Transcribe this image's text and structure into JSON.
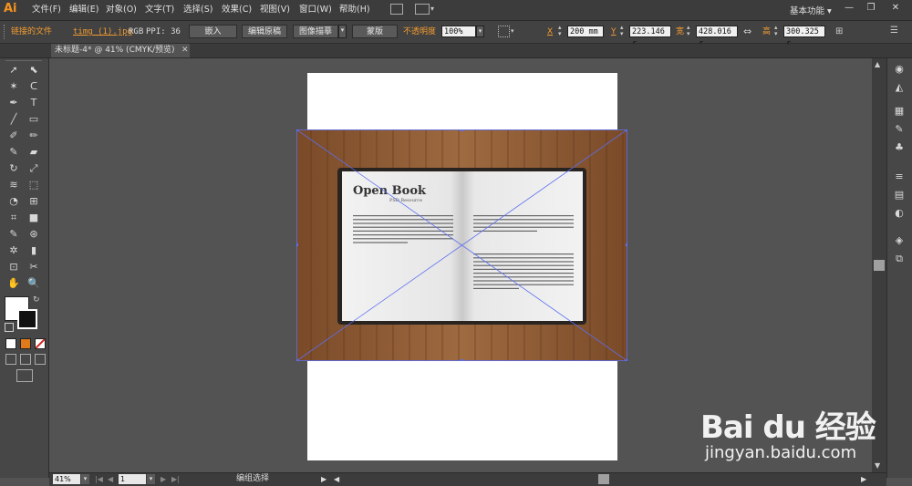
{
  "app": {
    "logo": "Ai"
  },
  "menu": [
    "文件(F)",
    "编辑(E)",
    "对象(O)",
    "文字(T)",
    "选择(S)",
    "效果(C)",
    "视图(V)",
    "窗口(W)",
    "帮助(H)"
  ],
  "workspace": {
    "label": "基本功能",
    "arrow": "▾"
  },
  "window_controls": {
    "minimize": "—",
    "restore": "❐",
    "close": "✕"
  },
  "control_bar": {
    "linked_file_label": "链接的文件",
    "filename": "timg (1).jpg",
    "color_mode": "RGB",
    "ppi_label": "PPI: 36",
    "embed_button": "嵌入",
    "edit_original_button": "编辑原稿",
    "image_trace_button": "图像描摹",
    "mask_button": "蒙版",
    "opacity_label": "不透明度",
    "opacity_value": "100%",
    "x_label": "X",
    "x_value": "200 mm",
    "y_label": "Y",
    "y_value": "223.146 r",
    "w_label": "宽",
    "w_value": "428.016 r",
    "h_label": "高",
    "h_value": "300.325 r"
  },
  "document": {
    "tab_title": "未标题-4* @ 41% (CMYK/预览)",
    "close": "✕"
  },
  "image": {
    "book_title": "Open Book",
    "book_subtitle": "PSD Resource"
  },
  "status_bar": {
    "zoom": "41%",
    "page": "1",
    "status_text": "编组选择"
  },
  "watermark": {
    "logo": "Bai du 经验",
    "url": "jingyan.baidu.com"
  },
  "colors": {
    "accent_orange": "#f29b30",
    "selection_blue": "#4a6cf7",
    "wood": "#8a5a34"
  },
  "icons": {
    "tools": [
      "selection-tool-icon",
      "direct-selection-tool-icon",
      "magic-wand-icon",
      "lasso-icon",
      "pen-tool-icon",
      "type-tool-icon",
      "line-tool-icon",
      "rectangle-tool-icon",
      "paintbrush-icon",
      "pencil-icon",
      "blob-brush-icon",
      "eraser-icon",
      "rotate-icon",
      "scale-icon",
      "warp-icon",
      "free-transform-icon",
      "shape-builder-icon",
      "perspective-grid-icon",
      "mesh-icon",
      "gradient-icon",
      "eyedropper-icon",
      "blend-icon",
      "symbol-sprayer-icon",
      "column-graph-icon",
      "artboard-icon",
      "slice-icon",
      "hand-icon",
      "zoom-icon"
    ]
  }
}
